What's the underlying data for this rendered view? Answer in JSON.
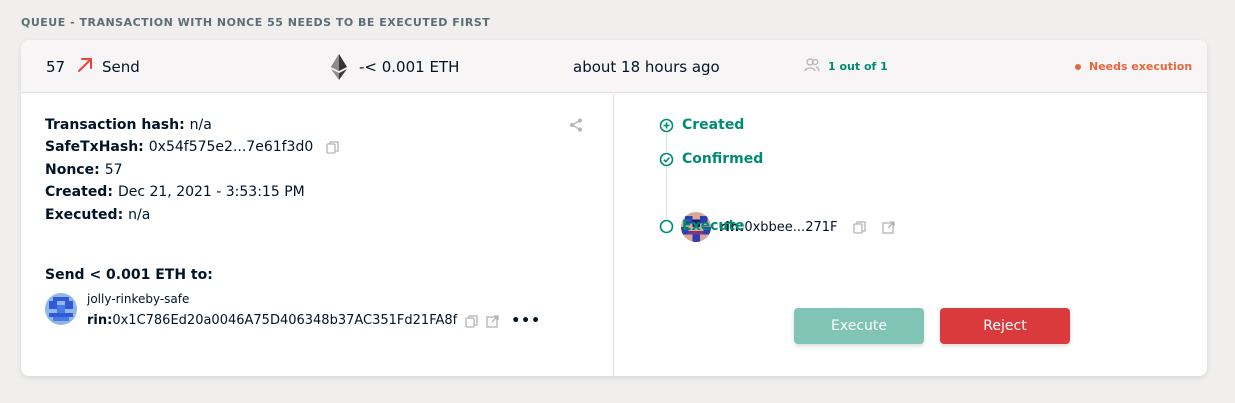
{
  "queue_label": "QUEUE - TRANSACTION WITH NONCE 55 NEEDS TO BE EXECUTED FIRST",
  "summary": {
    "nonce": "57",
    "type_label": "Send",
    "type_icon": "arrow-up-right-icon",
    "amount": "-< 0.001 ETH",
    "token_icon": "ethereum-icon",
    "time": "about 18 hours ago",
    "confirmations": "1 out of 1",
    "status": "Needs execution"
  },
  "details": {
    "tx_hash_label": "Transaction hash:",
    "tx_hash_value": "n/a",
    "safe_tx_hash_label": "SafeTxHash:",
    "safe_tx_hash_value": "0x54f575e2...7e61f3d0",
    "nonce_label": "Nonce:",
    "nonce_value": "57",
    "created_label": "Created:",
    "created_value": "Dec 21, 2021 - 3:53:15 PM",
    "executed_label": "Executed:",
    "executed_value": "n/a",
    "send_title": "Send < 0.001 ETH to:",
    "recipient_name": "jolly-rinkeby-safe",
    "recipient_prefix": "rin:",
    "recipient_address": "0x1C786Ed20a0046A75D406348b37AC351Fd21FA8f"
  },
  "timeline": {
    "created": "Created",
    "confirmed": "Confirmed",
    "owner_prefix": "rin:",
    "owner_address": "0xbbee...271F",
    "execute": "Execute"
  },
  "actions": {
    "execute": "Execute",
    "reject": "Reject"
  },
  "colors": {
    "accent": "#008c73",
    "warning": "#e8663d",
    "reject": "#db3a3d",
    "execute_disabled": "#80c4b6"
  }
}
